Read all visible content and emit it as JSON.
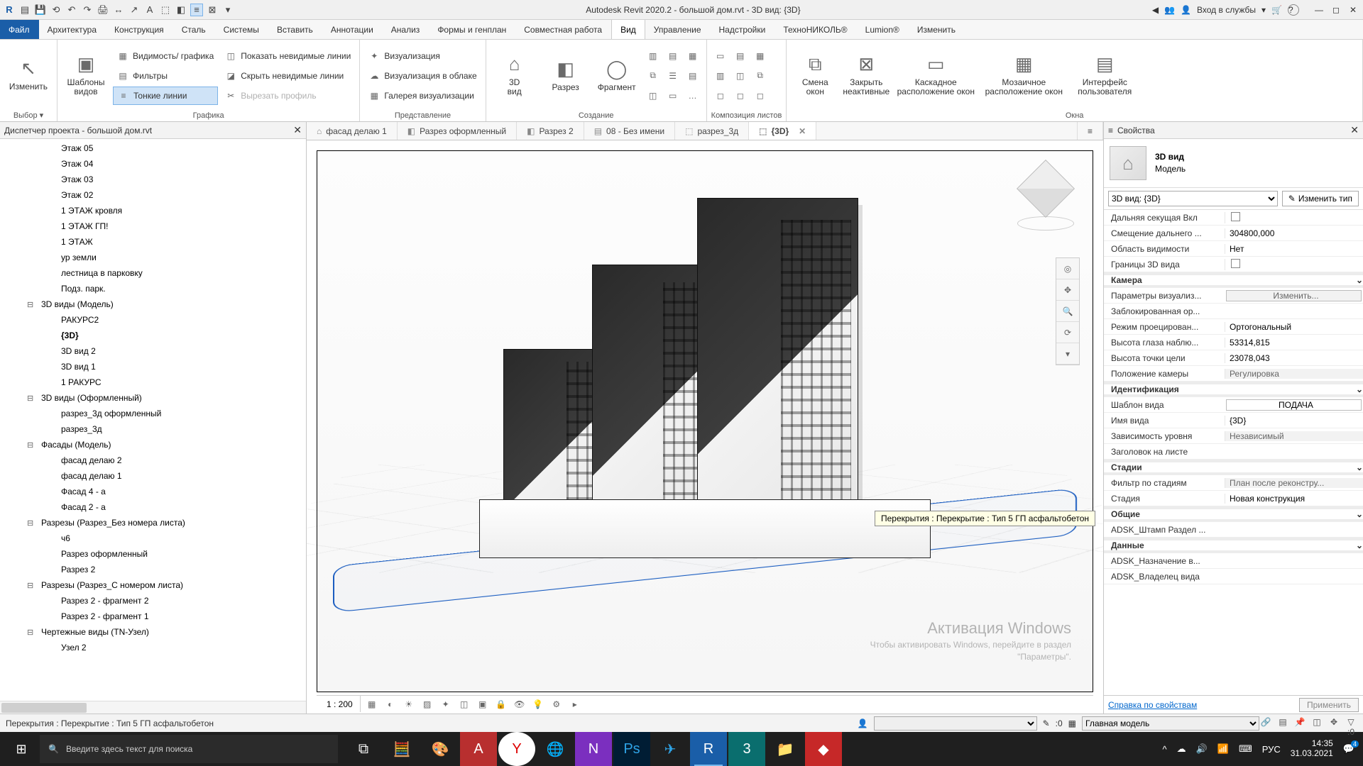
{
  "titlebar": {
    "title": "Autodesk Revit 2020.2 - большой дом.rvt - 3D вид: {3D}",
    "login": "Вход в службы",
    "icons": {
      "left_arrow": "◀",
      "people": "👥",
      "user": "👤",
      "cart": "🛒",
      "help": "?"
    }
  },
  "menutabs": [
    "Файл",
    "Архитектура",
    "Конструкция",
    "Сталь",
    "Системы",
    "Вставить",
    "Аннотации",
    "Анализ",
    "Формы и генплан",
    "Совместная работа",
    "Вид",
    "Управление",
    "Надстройки",
    "ТехноНИКОЛЬ®",
    "Lumion®",
    "Изменить"
  ],
  "active_menu_index": 10,
  "ribbon": {
    "groups": {
      "vybor": {
        "label": "Выбор ▾",
        "modify": "Изменить"
      },
      "grafika": {
        "label": "Графика",
        "templates": "Шаблоны\nвидов",
        "visibility": "Видимость/ графика",
        "filters": "Фильтры",
        "thinlines": "Тонкие линии",
        "show_hidden": "Показать невидимые линии",
        "hide_hidden": "Скрыть невидимые линии",
        "cut_profile": "Вырезать профиль"
      },
      "predstavlenie": {
        "label": "Представление",
        "render": "Визуализация",
        "cloud_render": "Визуализация в облаке",
        "gallery": "Галерея  визуализации"
      },
      "sozdanie": {
        "label": "Создание",
        "view3d": "3D\nвид",
        "section": "Разрез",
        "fragment": "Фрагмент"
      },
      "listy": {
        "label": "Композиция листов"
      },
      "okna": {
        "label": "Окна",
        "switch": "Смена\nокон",
        "close_inactive": "Закрыть\nнеактивные",
        "cascade": "Каскадное\nрасположение окон",
        "tile": "Мозаичное\nрасположение окон",
        "ui": "Интерфейс\nпользователя"
      }
    }
  },
  "viewtabs": [
    {
      "icon": "⌂",
      "label": "фасад делаю 1"
    },
    {
      "icon": "◧",
      "label": "Разрез оформленный"
    },
    {
      "icon": "◧",
      "label": "Разрез 2"
    },
    {
      "icon": "▤",
      "label": "08 - Без имени"
    },
    {
      "icon": "⬚",
      "label": "разрез_3д"
    },
    {
      "icon": "⬚",
      "label": "{3D}",
      "active": true
    }
  ],
  "project_browser": {
    "title": "Диспетчер проекта - большой дом.rvt",
    "items": [
      {
        "lvl": 2,
        "label": "Этаж 05"
      },
      {
        "lvl": 2,
        "label": "Этаж 04"
      },
      {
        "lvl": 2,
        "label": "Этаж 03"
      },
      {
        "lvl": 2,
        "label": "Этаж 02"
      },
      {
        "lvl": 2,
        "label": "1 ЭТАЖ кровля"
      },
      {
        "lvl": 2,
        "label": "1 ЭТАЖ ГП!"
      },
      {
        "lvl": 2,
        "label": "1 ЭТАЖ"
      },
      {
        "lvl": 2,
        "label": "ур земли"
      },
      {
        "lvl": 2,
        "label": "лестница в парковку"
      },
      {
        "lvl": 2,
        "label": "Подз. парк."
      },
      {
        "lvl": 1,
        "label": "3D виды (Модель)",
        "exp": true
      },
      {
        "lvl": 2,
        "label": "РАКУРС2"
      },
      {
        "lvl": 2,
        "label": "{3D}",
        "bold": true
      },
      {
        "lvl": 2,
        "label": "3D вид 2"
      },
      {
        "lvl": 2,
        "label": "3D вид 1"
      },
      {
        "lvl": 2,
        "label": "1 РАКУРС"
      },
      {
        "lvl": 1,
        "label": "3D виды (Оформленный)",
        "exp": true
      },
      {
        "lvl": 2,
        "label": "разрез_3д оформленный"
      },
      {
        "lvl": 2,
        "label": "разрез_3д"
      },
      {
        "lvl": 1,
        "label": "Фасады (Модель)",
        "exp": true
      },
      {
        "lvl": 2,
        "label": "фасад делаю 2"
      },
      {
        "lvl": 2,
        "label": "фасад делаю 1"
      },
      {
        "lvl": 2,
        "label": "Фасад 4 - а"
      },
      {
        "lvl": 2,
        "label": "Фасад 2 - а"
      },
      {
        "lvl": 1,
        "label": "Разрезы (Разрез_Без номера листа)",
        "exp": true
      },
      {
        "lvl": 2,
        "label": "ч6"
      },
      {
        "lvl": 2,
        "label": "Разрез оформленный"
      },
      {
        "lvl": 2,
        "label": "Разрез 2"
      },
      {
        "lvl": 1,
        "label": "Разрезы (Разрез_С номером листа)",
        "exp": true
      },
      {
        "lvl": 2,
        "label": "Разрез 2 - фрагмент 2"
      },
      {
        "lvl": 2,
        "label": "Разрез 2 - фрагмент 1"
      },
      {
        "lvl": 1,
        "label": "Чертежные виды (TN-Узел)",
        "exp": true
      },
      {
        "lvl": 2,
        "label": "Узел 2"
      }
    ]
  },
  "tooltip": "Перекрытия : Перекрытие : Тип 5 ГП асфальтобетон",
  "watermark": {
    "t1": "Активация Windows",
    "t2": "Чтобы активировать Windows, перейдите в раздел",
    "t3": "\"Параметры\"."
  },
  "viewctrl": {
    "scale": "1 : 200"
  },
  "properties": {
    "title": "Свойства",
    "type_name": "3D вид",
    "type_sub": "Модель",
    "selector": "3D вид: {3D}",
    "edit_type": "Изменить тип",
    "rows": [
      {
        "k": "Дальняя секущая Вкл",
        "v": "",
        "chk": false
      },
      {
        "k": "Смещение дальнего ...",
        "v": "304800,000"
      },
      {
        "k": "Область видимости",
        "v": "Нет"
      },
      {
        "k": "Границы 3D вида",
        "v": "",
        "chk": false
      },
      {
        "k": "Камера",
        "section": true
      },
      {
        "k": "Параметры визуализ...",
        "v": "Изменить...",
        "btn": true,
        "ro": true
      },
      {
        "k": "Заблокированная ор...",
        "v": "",
        "ro": true
      },
      {
        "k": "Режим проецирован...",
        "v": "Ортогональный"
      },
      {
        "k": "Высота глаза наблю...",
        "v": "53314,815"
      },
      {
        "k": "Высота точки цели",
        "v": "23078,043"
      },
      {
        "k": "Положение камеры",
        "v": "Регулировка",
        "ro": true
      },
      {
        "k": "Идентификация",
        "section": true
      },
      {
        "k": "Шаблон вида",
        "v": "ПОДАЧА",
        "btn": true
      },
      {
        "k": "Имя вида",
        "v": "{3D}"
      },
      {
        "k": "Зависимость уровня",
        "v": "Независимый",
        "ro": true
      },
      {
        "k": "Заголовок на листе",
        "v": ""
      },
      {
        "k": "Стадии",
        "section": true
      },
      {
        "k": "Фильтр по стадиям",
        "v": "План после реконстру...",
        "ro": true
      },
      {
        "k": "Стадия",
        "v": "Новая конструкция"
      },
      {
        "k": "Общие",
        "section": true
      },
      {
        "k": "ADSK_Штамп Раздел ...",
        "v": "",
        "ro": true
      },
      {
        "k": "Данные",
        "section": true
      },
      {
        "k": "ADSK_Назначение в...",
        "v": "",
        "ro": true
      },
      {
        "k": "ADSK_Владелец вида",
        "v": "",
        "ro": true
      }
    ],
    "help": "Справка по свойствам",
    "apply": "Применить"
  },
  "statusbar": {
    "status": "Перекрытия : Перекрытие : Тип 5 ГП асфальтобетон",
    "zero": ":0",
    "main_model": "Главная модель",
    "filter_zero": "▽ :0"
  },
  "taskbar": {
    "search_placeholder": "Введите здесь текст для поиска",
    "clock_time": "14:35",
    "clock_date": "31.03.2021",
    "lang": "РУС",
    "notif": "4"
  }
}
